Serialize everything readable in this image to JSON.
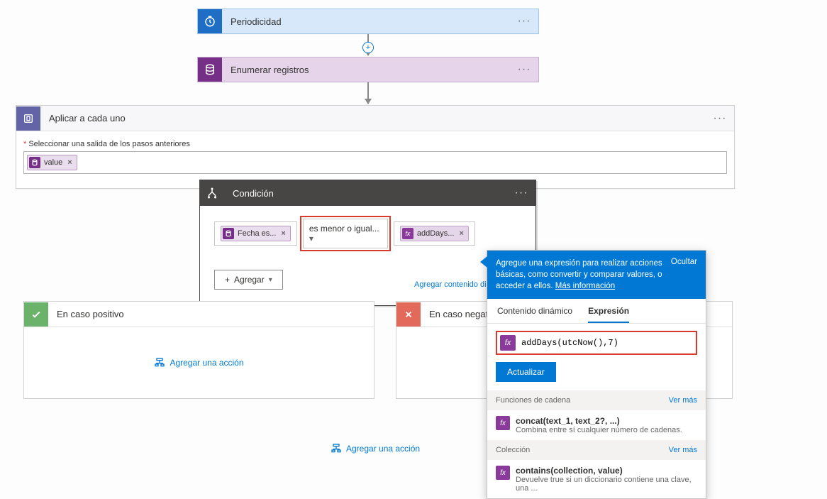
{
  "trigger": {
    "title": "Periodicidad"
  },
  "enum": {
    "title": "Enumerar registros"
  },
  "foreach": {
    "title": "Aplicar a cada uno",
    "selectLabel": "Seleccionar una salida de los pasos anteriores",
    "token": "value",
    "ellipsis": "···"
  },
  "condition": {
    "title": "Condición",
    "left_token": "Fecha es...",
    "operator": "es menor o igual...",
    "right_token": "addDays...",
    "addContent": "Agregar contenido dinámico",
    "addBtn": "Agregar"
  },
  "branches": {
    "yes": "En caso positivo",
    "no": "En caso negativo",
    "addAction": "Agregar una acción"
  },
  "bottom": {
    "addAction": "Agregar una acción"
  },
  "expr": {
    "info": "Agregue una expresión para realizar acciones básicas, como convertir y comparar valores, o acceder a ellos.",
    "learn": "Más información",
    "hide": "Ocultar",
    "tabDynamic": "Contenido dinámico",
    "tabExpr": "Expresión",
    "input": "addDays(utcNow(),7)",
    "update": "Actualizar",
    "sectionStrings": "Funciones de cadena",
    "sectionCollection": "Colección",
    "seeMore": "Ver más",
    "fn1_name": "concat(text_1, text_2?, ...)",
    "fn1_desc": "Combina entre sí cualquier número de cadenas.",
    "fn2_name": "contains(collection, value)",
    "fn2_desc": "Devuelve true si un diccionario contiene una clave, una ..."
  }
}
